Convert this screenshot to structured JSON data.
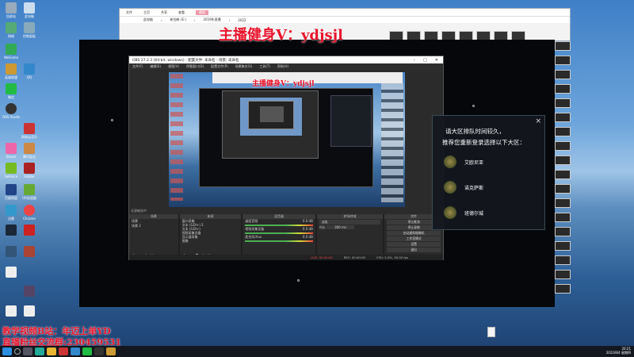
{
  "explorer": {
    "tabs": [
      "文件",
      "主页",
      "共享",
      "查看",
      "视频工具"
    ],
    "active_tab": "播放",
    "path": [
      "此电脑",
      "新加卷 (E:)",
      "2019年直播",
      "2022"
    ]
  },
  "overlay": {
    "watermark_top": "主播健身V：ydjsjl",
    "caption_line1": "教学视频B站：年迈上单YD",
    "caption_line2": "直播粉丝交流群:230459531"
  },
  "obs": {
    "title": "OBS 27.2.3 (64-bit, windows) - 配置文件: 未命名 - 场景: 未命名",
    "menu": [
      "文件(F)",
      "编辑(E)",
      "视图(V)",
      "停靠窗口(D)",
      "配置文件(P)",
      "场景集合(S)",
      "工具(T)",
      "帮助(H)"
    ],
    "inner_text": "主播健身V：ydjsjl",
    "status_bar": "无源被选中",
    "docks": {
      "scenes": {
        "header": "场景",
        "items": [
          "场景",
          "场景 2"
        ]
      },
      "sources": {
        "header": "来源",
        "items": [
          "窗口采集",
          "文本 (GDI+) 2",
          "文本 (GDI+)",
          "视频采集设备",
          "显示器采集",
          "图像"
        ]
      },
      "mixer": {
        "header": "混音器",
        "tracks": [
          "桌面音频",
          "视频采集设备",
          "麦克风/Aux"
        ],
        "level": "0.0 dB"
      },
      "transitions": {
        "header": "转场特效",
        "type": "淡出",
        "duration_label": "时长",
        "duration": "300 ms"
      },
      "controls": {
        "header": "控件",
        "buttons": [
          "停止推流",
          "停止录制",
          "启动虚拟摄像机",
          "工作室模式",
          "设置",
          "退出"
        ]
      }
    },
    "stats": {
      "live": "LIVE: 00:00:00",
      "rec": "REC: 00:00:00",
      "cpu": "CPU: 3.0%, 30.00 fps"
    }
  },
  "dialog": {
    "line1": "请大区排队时间较久，",
    "line2": "推荐您重新登录选择以下大区：",
    "servers": [
      "艾欧尼亚",
      "诺克萨斯",
      "班德尔城"
    ],
    "close": "×"
  },
  "desktop_icons": [
    "回收站",
    "此电脑",
    "网络",
    "控制面板",
    "WeGame",
    "英雄联盟",
    "QQ",
    "微信",
    "OBS Studio",
    "网易云音乐",
    "Steam",
    "腾讯会议",
    "GeForce",
    "Adobe",
    "百度网盘",
    "UU加速器",
    "迅雷",
    "Chrome"
  ],
  "taskbar": {
    "time": "20:21",
    "date": "2022/8/4 星期四"
  }
}
